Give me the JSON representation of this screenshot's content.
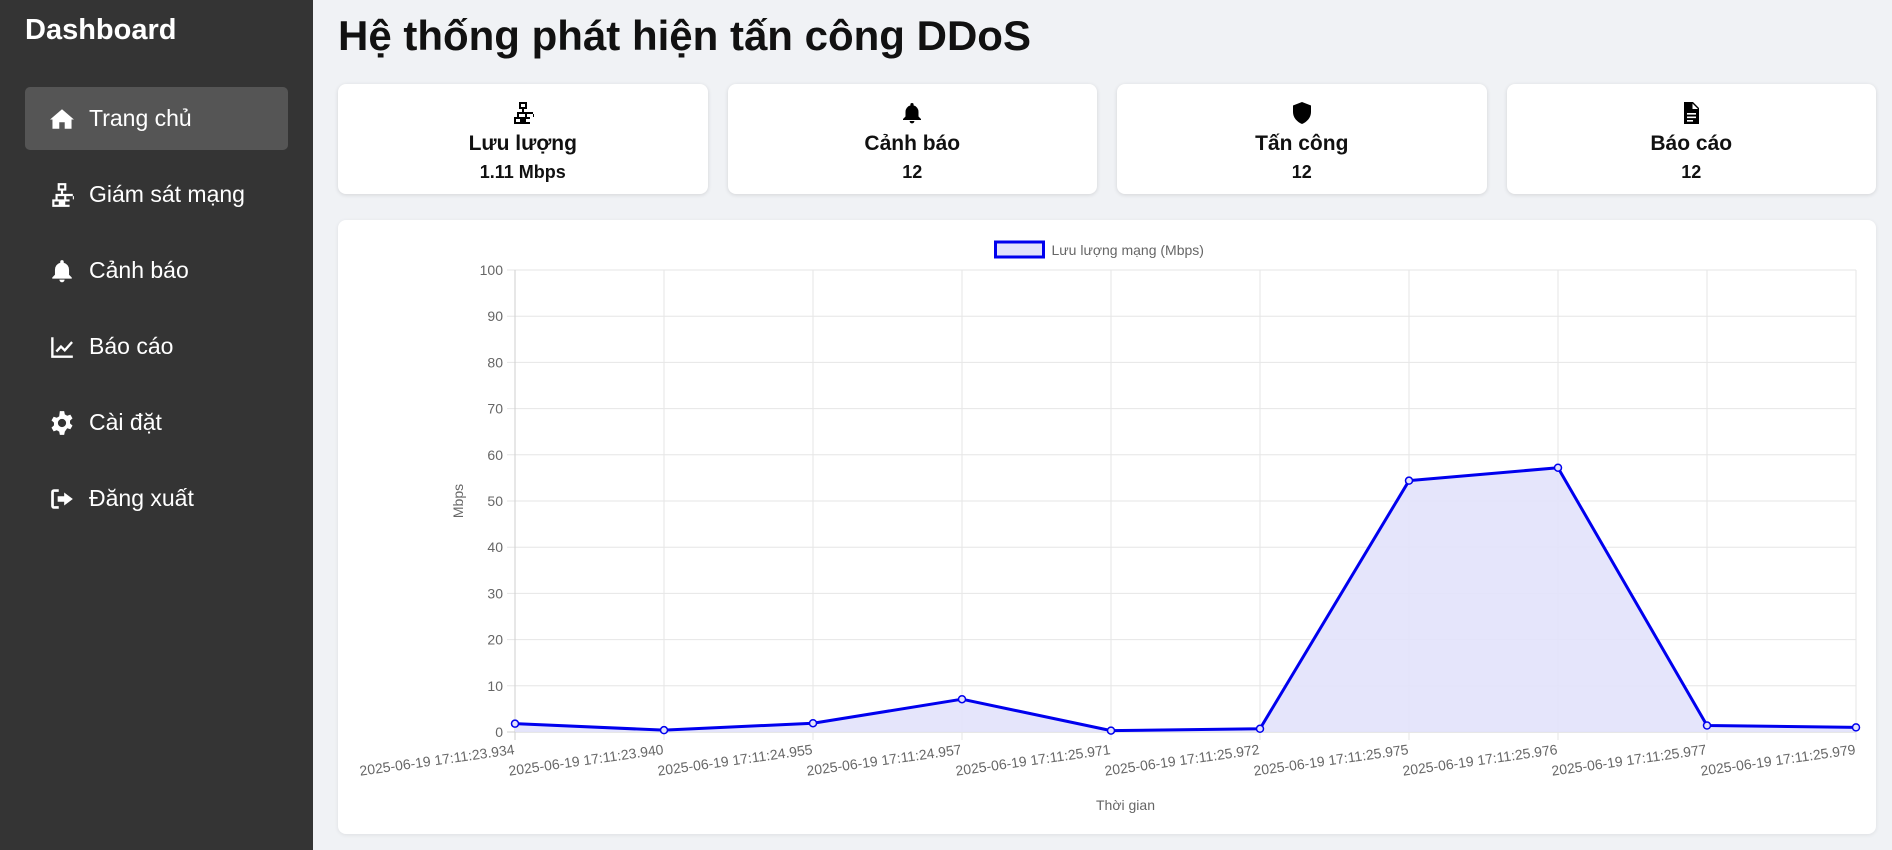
{
  "sidebar": {
    "brand": "Dashboard",
    "items": [
      {
        "label": "Trang chủ",
        "icon": "home-icon",
        "active": true
      },
      {
        "label": "Giám sát mạng",
        "icon": "network-icon",
        "active": false
      },
      {
        "label": "Cảnh báo",
        "icon": "bell-icon",
        "active": false
      },
      {
        "label": "Báo cáo",
        "icon": "chart-line-icon",
        "active": false
      },
      {
        "label": "Cài đặt",
        "icon": "gear-icon",
        "active": false
      },
      {
        "label": "Đăng xuất",
        "icon": "sign-out-icon",
        "active": false
      }
    ]
  },
  "main": {
    "title": "Hệ thống phát hiện tấn công DDoS",
    "cards": [
      {
        "title": "Lưu lượng",
        "value": "1.11 Mbps",
        "icon": "network-icon"
      },
      {
        "title": "Cảnh báo",
        "value": "12",
        "icon": "bell-icon"
      },
      {
        "title": "Tấn công",
        "value": "12",
        "icon": "shield-icon"
      },
      {
        "title": "Báo cáo",
        "value": "12",
        "icon": "file-icon"
      }
    ]
  },
  "colors": {
    "sidebar_bg": "#343434",
    "active_item_bg": "#555555",
    "line": "#0000ee",
    "fill": "#e2e2fb"
  },
  "chart_data": {
    "type": "line",
    "legend": "Lưu lượng mạng (Mbps)",
    "legend_position": "top",
    "xlabel": "Thời gian",
    "ylabel": "Mbps",
    "ylim": [
      0,
      100
    ],
    "yticks": [
      0,
      10,
      20,
      30,
      40,
      50,
      60,
      70,
      80,
      90,
      100
    ],
    "grid": true,
    "x": [
      "2025-06-19 17:11:23.934",
      "2025-06-19 17:11:23.940",
      "2025-06-19 17:11:24.955",
      "2025-06-19 17:11:24.957",
      "2025-06-19 17:11:25.971",
      "2025-06-19 17:11:25.972",
      "2025-06-19 17:11:25.975",
      "2025-06-19 17:11:25.976",
      "2025-06-19 17:11:25.977",
      "2025-06-19 17:11:25.979"
    ],
    "series": [
      {
        "name": "Lưu lượng mạng (Mbps)",
        "values": [
          1.8,
          0.4,
          1.9,
          7.1,
          0.3,
          0.7,
          54.4,
          57.2,
          1.4,
          1.0
        ]
      }
    ]
  }
}
